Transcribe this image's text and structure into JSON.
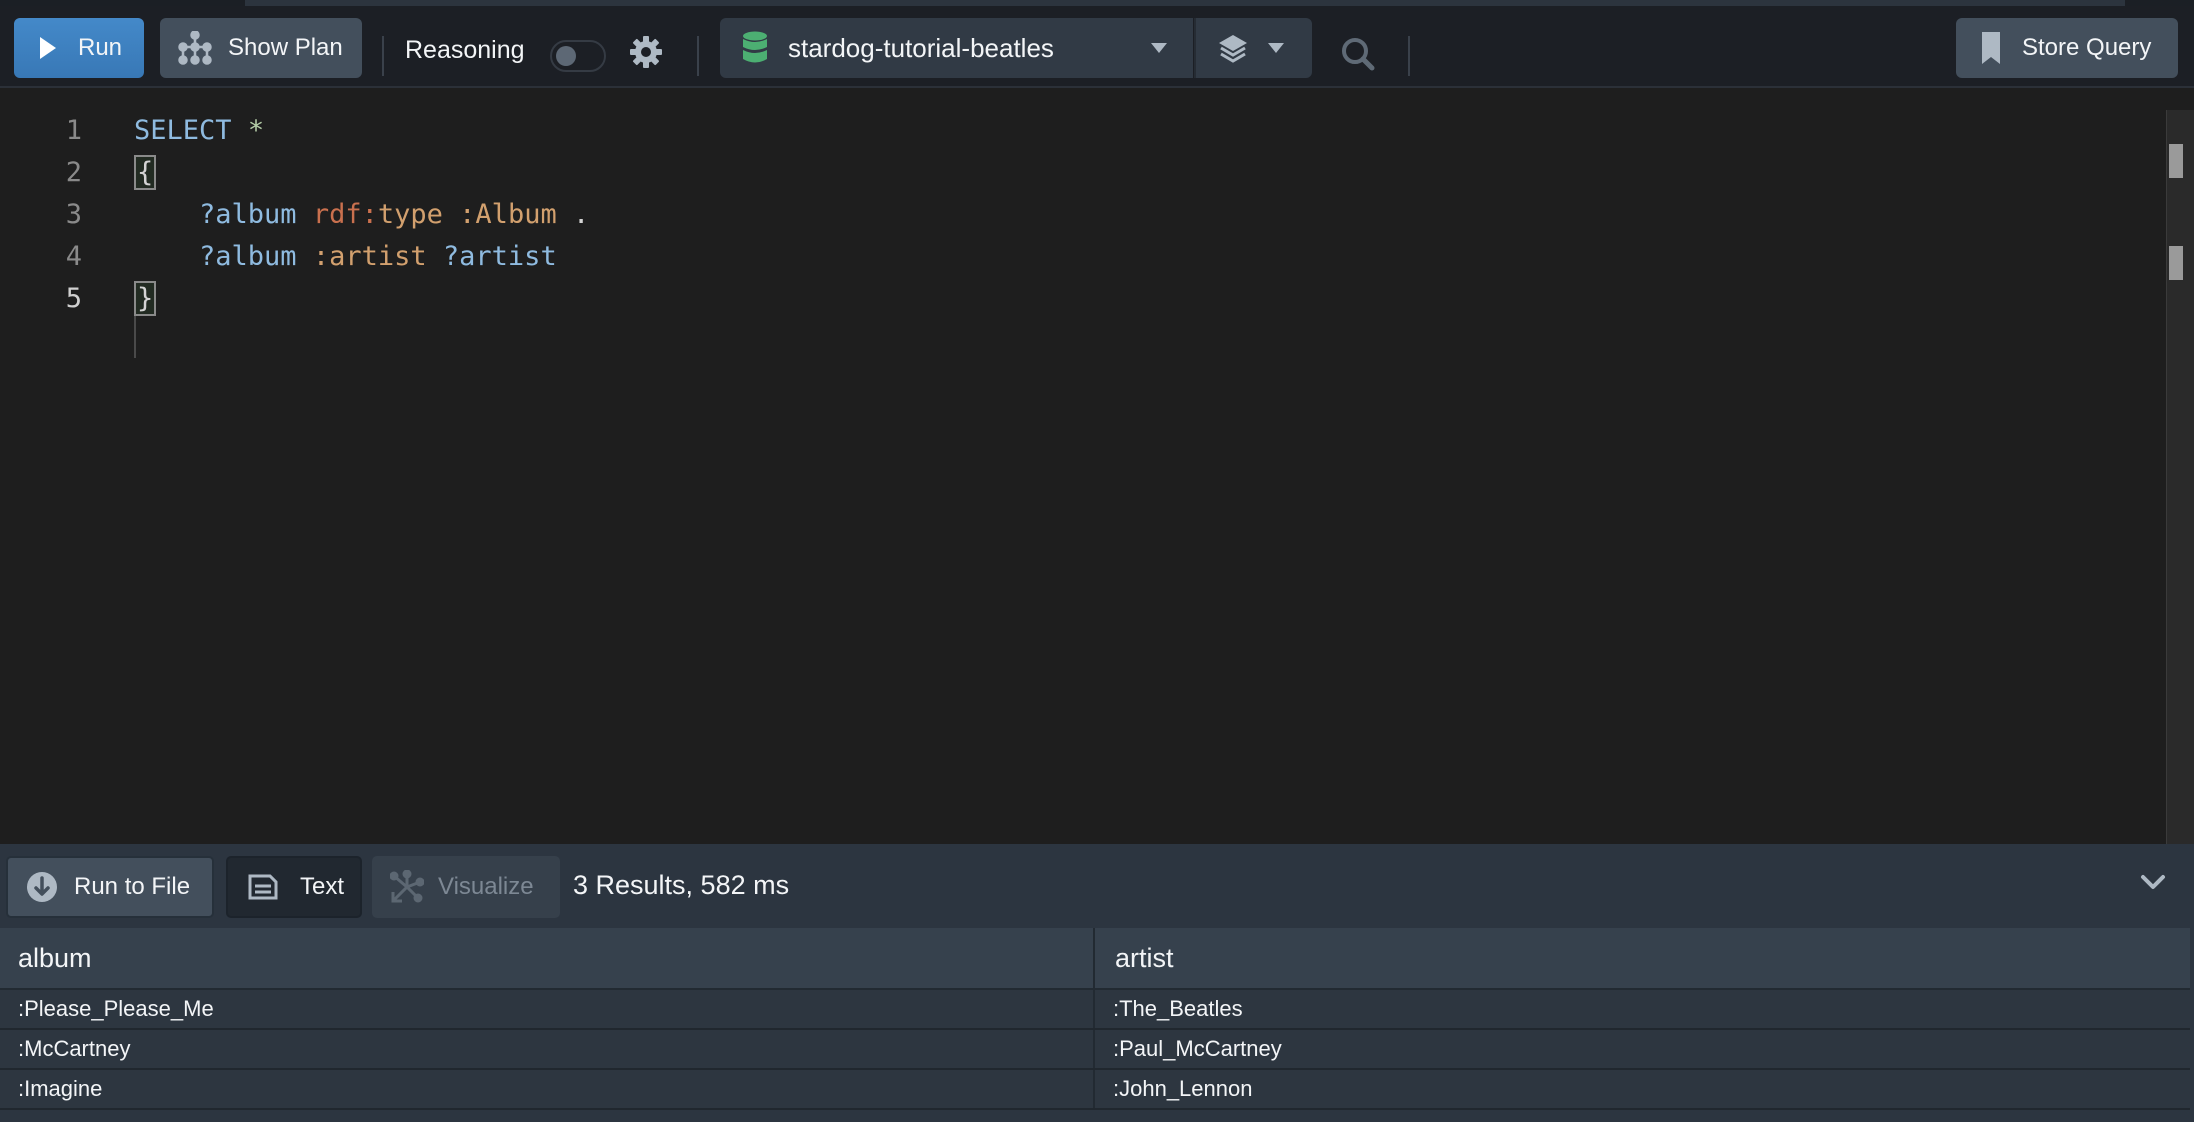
{
  "toolbar": {
    "run_label": "Run",
    "show_plan_label": "Show Plan",
    "reasoning_label": "Reasoning",
    "reasoning_enabled": false,
    "database": "stardog-tutorial-beatles",
    "store_query_label": "Store Query"
  },
  "editor": {
    "lines": [
      {
        "number": "1",
        "text": "SELECT *"
      },
      {
        "number": "2",
        "text": "{"
      },
      {
        "number": "3",
        "text": "    ?album rdf:type :Album ."
      },
      {
        "number": "4",
        "text": "    ?album :artist ?artist"
      },
      {
        "number": "5",
        "text": "}"
      }
    ],
    "tokens": {
      "select": "SELECT",
      "star": "*",
      "open_brace": "{",
      "close_brace": "}",
      "album_var": "?album",
      "rdf_prefix": "rdf:",
      "type_local": "type",
      "album_iri": ":Album",
      "dot": ".",
      "artist_pred": ":artist",
      "artist_var": "?artist"
    }
  },
  "results": {
    "run_to_file_label": "Run to File",
    "text_label": "Text",
    "visualize_label": "Visualize",
    "count_text": "3 Results,  582 ms",
    "columns": [
      "album",
      "artist"
    ],
    "rows": [
      [
        ":Please_Please_Me",
        ":The_Beatles"
      ],
      [
        ":McCartney",
        ":Paul_McCartney"
      ],
      [
        ":Imagine",
        ":John_Lennon"
      ]
    ]
  },
  "colors": {
    "run_button": "#3d80c0",
    "database_icon": "#4caf72"
  }
}
